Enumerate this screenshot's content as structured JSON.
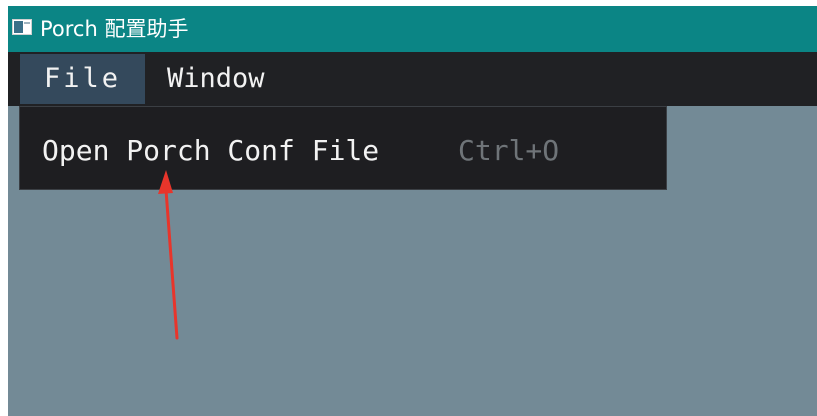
{
  "window": {
    "title": "Porch 配置助手",
    "icon": "app-window-icon"
  },
  "menubar": {
    "items": [
      {
        "label": "File",
        "active": true
      },
      {
        "label": "Window",
        "active": false
      }
    ]
  },
  "dropdown": {
    "items": [
      {
        "label": "Open Porch Conf File",
        "shortcut": "Ctrl+O"
      }
    ]
  },
  "annotation": {
    "type": "red-arrow",
    "color": "#e8352b",
    "points_to": "Open Porch Conf File"
  },
  "colors": {
    "titlebar": "#0b8585",
    "menubar": "#202124",
    "menu_active": "#34495c",
    "workspace": "#738a96",
    "dropdown": "#1e1e21",
    "shortcut_text": "#6f7478"
  }
}
